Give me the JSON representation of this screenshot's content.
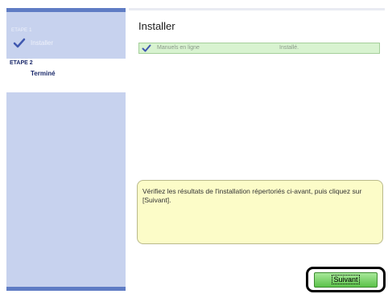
{
  "sidebar": {
    "steps": [
      {
        "number": "ETAPE 1",
        "label": "Installer",
        "state": "completed",
        "icon": "check-icon"
      },
      {
        "number": "ETAPE 2",
        "label": "Terminé",
        "state": "current"
      }
    ]
  },
  "main": {
    "title": "Installer",
    "results": [
      {
        "icon": "check-icon",
        "name": "Manuels en ligne",
        "status": "Installé."
      }
    ],
    "message": "Vérifiez les résultats de l'installation répertoriés ci-avant, puis cliquez sur [Suivant]."
  },
  "footer": {
    "next_label": "Suivant"
  },
  "colors": {
    "sidebar_bg": "#c7d2ee",
    "sidebar_border": "#5f7cc4",
    "step_text": "#1b2a6b",
    "result_row_bg": "#d8f3d0",
    "message_bg": "#fcfcc8",
    "button_green": "#5cc24a"
  }
}
